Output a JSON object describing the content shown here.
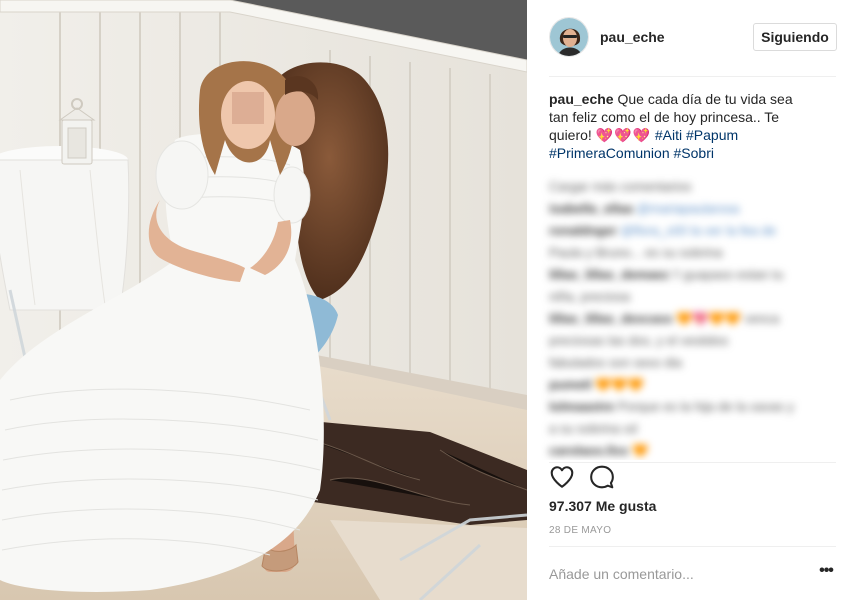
{
  "post": {
    "username": "pau_eche",
    "follow_label": "Siguiendo",
    "caption": {
      "author": "pau_eche",
      "line1": "Que cada día de tu vida sea",
      "line2": "tan feliz como el de hoy princesa.. Te",
      "line3_text": "quiero!",
      "hearts": "💖💖💖",
      "tag1": "#Aiti",
      "tag2": "#Papum",
      "tag3": "#PrimeraComunion",
      "tag4": "#Sobri"
    },
    "likes": "97.307 Me gusta",
    "date": "28 DE MAYO",
    "comment_placeholder": "Añade un comentario...",
    "more_label": "•••"
  },
  "comments": [
    {
      "user": "",
      "text": "Cargar más comentarios"
    },
    {
      "user": "isabella_ellaa",
      "text": "@mariapaularosa"
    },
    {
      "user": "ronaldnger",
      "text": "@flora_x00 la ver la fea de"
    },
    {
      "user": "",
      "text": "Paula y Bruno... es su sobrina"
    },
    {
      "user": "lillas_lillas_demaez",
      "text": "!! guapaso estan tu"
    },
    {
      "user": "",
      "text": "niña, preciosa"
    },
    {
      "user": "lillas_lillas_dexcass",
      "text": "🧡💖🧡🧡 venca"
    },
    {
      "user": "",
      "text": "preciosas las dos, y el vestidos"
    },
    {
      "user": "",
      "text": "fabulados son sexo dia"
    },
    {
      "user": "pumetl",
      "text": "🧡🧡🧡"
    },
    {
      "user": "lolmaaxtre",
      "text": "Porque es la hija de la xavas y"
    },
    {
      "user": "",
      "text": "a su sobrina xd"
    },
    {
      "user": "carolaoo.llxx",
      "text": "🧡"
    }
  ],
  "icons": {
    "like": "heart-outline-icon",
    "comment": "speech-bubble-icon",
    "avatar": "profile-picture"
  }
}
